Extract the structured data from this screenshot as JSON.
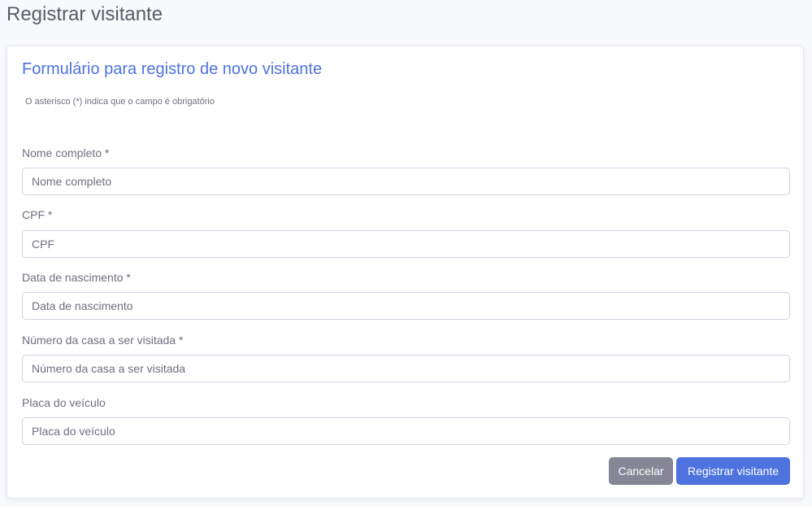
{
  "page": {
    "title": "Registrar visitante"
  },
  "form": {
    "title": "Formulário para registro de novo visitante",
    "note": "O asterisco (*) indica que o campo é obrigatório",
    "fields": [
      {
        "label": "Nome completo *",
        "placeholder": "Nome completo",
        "value": ""
      },
      {
        "label": "CPF *",
        "placeholder": "CPF",
        "value": ""
      },
      {
        "label": "Data de nascimento *",
        "placeholder": "Data de nascimento",
        "value": ""
      },
      {
        "label": "Número da casa a ser visitada *",
        "placeholder": "Número da casa a ser visitada",
        "value": ""
      },
      {
        "label": "Placa do veículo",
        "placeholder": "Placa do veículo",
        "value": ""
      }
    ],
    "buttons": {
      "cancel": "Cancelar",
      "submit": "Registrar visitante"
    }
  },
  "colors": {
    "accent": "#4e73df",
    "cancel": "#858796",
    "background": "#f8f9fc",
    "text": "#6e707e"
  }
}
